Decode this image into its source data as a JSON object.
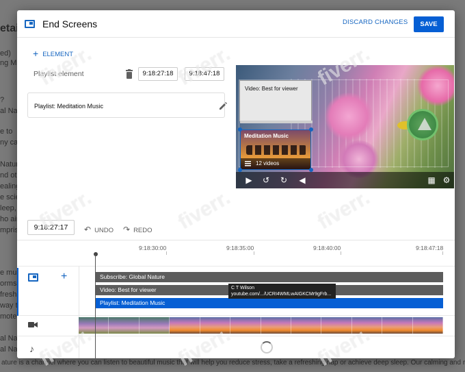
{
  "background_page": {
    "title_fragment": "etai",
    "lines": [
      "ed)",
      "ng Mu",
      "?",
      "al Nat",
      "e to",
      "ny car",
      "Nature",
      "nd oth",
      "ealing",
      "e scie",
      "leep,",
      "ho aim",
      "mpris",
      "e mus",
      "orms",
      "fresh",
      "way t",
      "mote",
      "al Nat",
      "al Nat"
    ],
    "bottom_text": "ature is a channel where you can listen to beautiful music that will help you reduce stress, take a refreshing nap or achieve deep sleep. Our calming and relaxing music is soft, slow and will"
  },
  "modal": {
    "title": "End Screens",
    "discard_label": "DISCARD CHANGES",
    "save_label": "SAVE",
    "add_element_label": "ELEMENT",
    "element_type_label": "Playlist element",
    "element_start_time": "9:18:27:18",
    "element_end_time": "9:18:47:18",
    "playlist_card_text": "Playlist: Meditation Music"
  },
  "preview": {
    "video_card_title": "Video: Best for viewer",
    "playlist_title": "Meditation Music",
    "playlist_count": "12 videos"
  },
  "timeline": {
    "current_time": "9:18:27:17",
    "undo_label": "UNDO",
    "redo_label": "REDO",
    "ticks": [
      "9:18:30:00",
      "9:18:35:00",
      "9:18:40:00",
      "9:18:47:18"
    ],
    "tracks": [
      {
        "label": "Subscribe: Global Nature",
        "style": "grey"
      },
      {
        "label": "Video: Best for viewer",
        "style": "grey"
      },
      {
        "label": "Playlist: Meditation Music",
        "style": "blue"
      }
    ],
    "tooltip_line1": "C T Wilson",
    "tooltip_line2": "youtube.com/.../UCRI4WMLwAIGKCMr9gFrb..."
  },
  "watermark_text": "fiverr.",
  "colors": {
    "accent": "#065fd4",
    "link": "#1565c0",
    "track_grey": "#5c5c5c"
  }
}
